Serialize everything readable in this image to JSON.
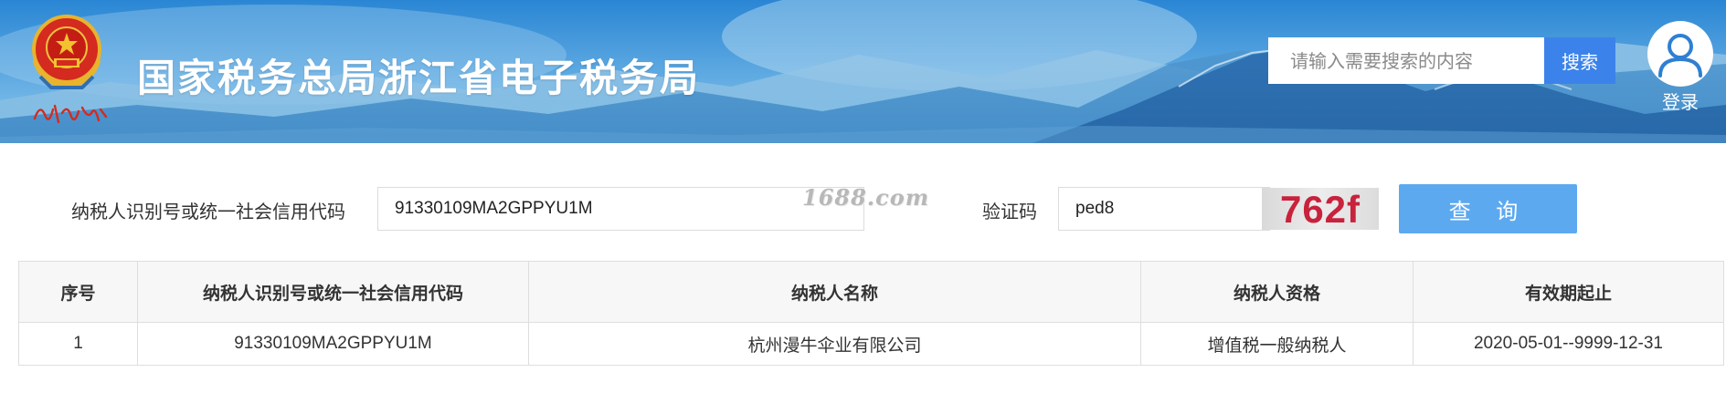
{
  "header": {
    "site_title": "国家税务总局浙江省电子税务局",
    "emblem_icon": "tax-emblem-icon",
    "emblem_signature": "中国税务",
    "search": {
      "placeholder": "请输入需要搜索的内容",
      "button_label": "搜索"
    },
    "login": {
      "icon": "user-icon",
      "label": "登录"
    },
    "colors": {
      "banner_blue": "#2f8fd8",
      "search_button": "#3b83ea",
      "emblem_red": "#d42a1f",
      "emblem_gold": "#e8b32d"
    }
  },
  "query_form": {
    "code_label": "纳税人识别号或统一社会信用代码",
    "code_value": "91330109MA2GPPYU1M",
    "watermark": "1688.com",
    "captcha_label": "验证码",
    "captcha_value": "ped8",
    "captcha_image_text": "762f",
    "query_button_label": "查 询",
    "colors": {
      "query_button": "#5ca9f0",
      "captcha_text": "#c8223c"
    }
  },
  "results": {
    "headers": [
      "序号",
      "纳税人识别号或统一社会信用代码",
      "纳税人名称",
      "纳税人资格",
      "有效期起止"
    ],
    "rows": [
      [
        "1",
        "91330109MA2GPPYU1M",
        "杭州漫牛伞业有限公司",
        "增值税一般纳税人",
        "2020-05-01--9999-12-31"
      ]
    ]
  }
}
